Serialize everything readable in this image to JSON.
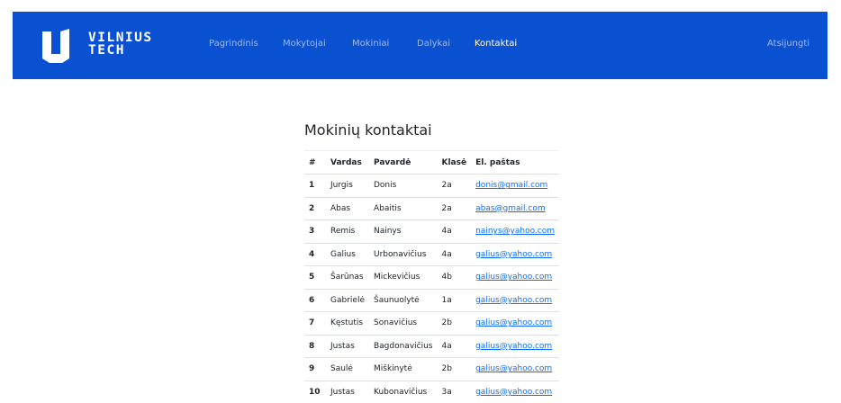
{
  "header": {
    "logo_line1": "VILNIUS",
    "logo_line2": "TECH",
    "nav": [
      {
        "label": "Pagrindinis"
      },
      {
        "label": "Mokytojai"
      },
      {
        "label": "Mokiniai"
      },
      {
        "label": "Dalykai"
      },
      {
        "label": "Kontaktai",
        "active": true
      }
    ],
    "logout_label": "Atsijungti",
    "brand_color": "#0a51d2"
  },
  "main": {
    "title": "Mokinių kontaktai",
    "table": {
      "columns": [
        "#",
        "Vardas",
        "Pavardė",
        "Klasė",
        "El. paštas"
      ],
      "rows": [
        {
          "num": "1",
          "vardas": "Jurgis",
          "pavarde": "Donis",
          "klase": "2a",
          "email": "donis@gmail.com"
        },
        {
          "num": "2",
          "vardas": "Abas",
          "pavarde": "Abaitis",
          "klase": "2a",
          "email": "abas@gmail.com"
        },
        {
          "num": "3",
          "vardas": "Remis",
          "pavarde": "Nainys",
          "klase": "4a",
          "email": "nainys@yahoo.com"
        },
        {
          "num": "4",
          "vardas": "Galius",
          "pavarde": "Urbonavičius",
          "klase": "4a",
          "email": "galius@yahoo.com"
        },
        {
          "num": "5",
          "vardas": "Šarūnas",
          "pavarde": "Mickevičius",
          "klase": "4b",
          "email": "galius@yahoo.com"
        },
        {
          "num": "6",
          "vardas": "Gabrielė",
          "pavarde": "Šaunuolytė",
          "klase": "1a",
          "email": "galius@yahoo.com"
        },
        {
          "num": "7",
          "vardas": "Kęstutis",
          "pavarde": "Sonavičius",
          "klase": "2b",
          "email": "galius@yahoo.com"
        },
        {
          "num": "8",
          "vardas": "Justas",
          "pavarde": "Bagdonavičius",
          "klase": "4a",
          "email": "galius@yahoo.com"
        },
        {
          "num": "9",
          "vardas": "Saulė",
          "pavarde": "Miškinytė",
          "klase": "2b",
          "email": "galius@yahoo.com"
        },
        {
          "num": "10",
          "vardas": "Justas",
          "pavarde": "Kubonavičius",
          "klase": "3a",
          "email": "galius@yahoo.com"
        }
      ]
    }
  }
}
